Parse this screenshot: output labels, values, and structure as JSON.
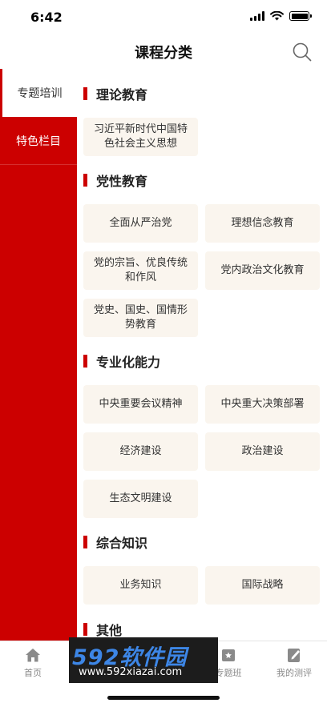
{
  "status_bar": {
    "time": "6:42"
  },
  "nav": {
    "title": "课程分类",
    "search_icon": "search-icon"
  },
  "sidebar": {
    "items": [
      {
        "label": "专题培训",
        "active": true
      },
      {
        "label": "特色栏目",
        "active": false
      }
    ]
  },
  "sections": [
    {
      "title": "理论教育",
      "items": [
        "习近平新时代中国特色社会主义思想"
      ]
    },
    {
      "title": "党性教育",
      "items": [
        "全面从严治党",
        "理想信念教育",
        "党的宗旨、优良传统和作风",
        "党内政治文化教育",
        "党史、国史、国情形势教育"
      ]
    },
    {
      "title": "专业化能力",
      "items": [
        "中央重要会议精神",
        "中央重大决策部署",
        "经济建设",
        "政治建设",
        "生态文明建设"
      ]
    },
    {
      "title": "综合知识",
      "items": [
        "业务知识",
        "国际战略"
      ]
    },
    {
      "title": "其他",
      "items": []
    }
  ],
  "tabbar": {
    "items": [
      {
        "label": "首页",
        "icon": "home-icon"
      },
      {
        "label": "专题班",
        "icon": "badge-icon"
      },
      {
        "label": "我的测评",
        "icon": "edit-icon"
      }
    ]
  },
  "watermark": {
    "big": "592软件园",
    "small": "www.592xiazai.com"
  },
  "colors": {
    "accent": "#cc0000",
    "chip_bg": "#faf5ee"
  }
}
